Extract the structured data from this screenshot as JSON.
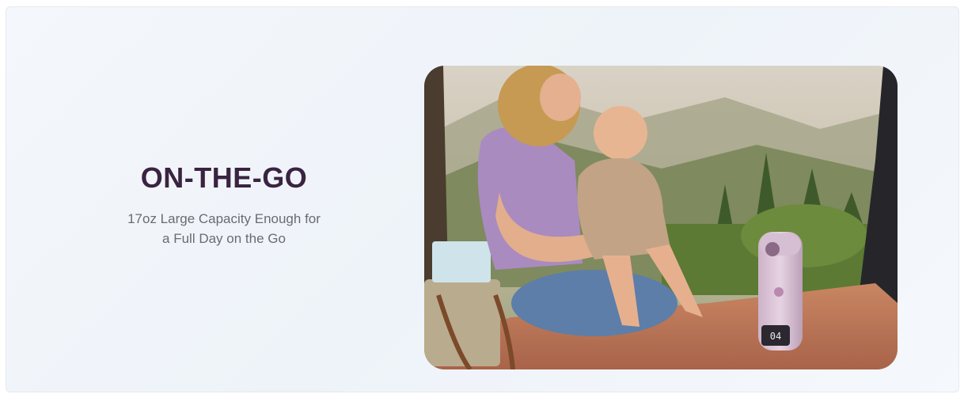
{
  "feature": {
    "title": "ON-THE-GO",
    "subtitle_line1": "17oz Large Capacity Enough for",
    "subtitle_line2": "a Full Day on the Go"
  },
  "photo": {
    "alt": "Mother with baby sitting on a blanket in a car trunk with a portable bottle warmer",
    "device_display": "04"
  },
  "colors": {
    "title": "#3a2341",
    "subtitle": "#6a6b70",
    "card_bg": "#f1f5fa"
  }
}
